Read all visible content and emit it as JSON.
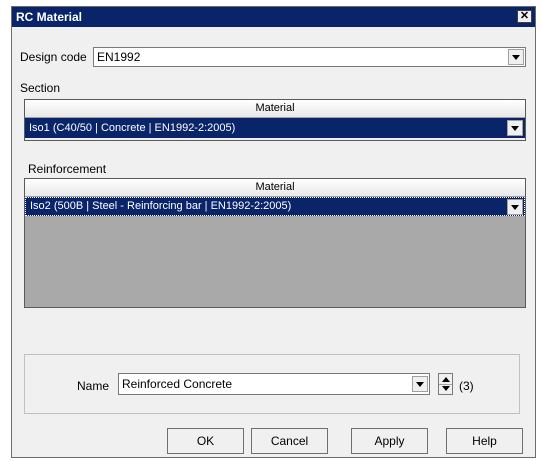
{
  "window": {
    "title": "RC Material",
    "close_glyph": "✕"
  },
  "design_code": {
    "label": "Design code",
    "value": "EN1992"
  },
  "section": {
    "label": "Section",
    "column_header": "Material",
    "selected": "Iso1 (C40/50 | Concrete | EN1992-2:2005)"
  },
  "reinforcement": {
    "label": "Reinforcement",
    "column_header": "Material",
    "selected": "Iso2 (500B | Steel - Reinforcing bar | EN1992-2:2005)"
  },
  "name": {
    "label": "Name",
    "value": "Reinforced Concrete",
    "count": "(3)"
  },
  "buttons": {
    "ok": "OK",
    "cancel": "Cancel",
    "apply": "Apply",
    "help": "Help"
  },
  "colors": {
    "titlebar": "#0a246a",
    "selection": "#0a246a",
    "grid_empty": "#a9a9a9"
  },
  "icons": {
    "close": "close-icon",
    "dropdown": "chevron-down-icon",
    "spinner": "spin-updown-icon"
  }
}
